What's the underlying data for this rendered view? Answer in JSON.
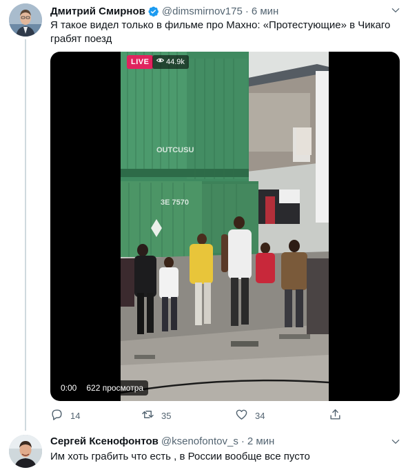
{
  "tweet": {
    "author_name": "Дмитрий Смирнов",
    "handle": "@dimsmirnov175",
    "separator": "·",
    "time": "6 мин",
    "text": "Я такое видел только в фильме про Махно: «Протестующие» в Чикаго грабят поезд",
    "media": {
      "live_label": "LIVE",
      "viewers": "44.9k",
      "video_time": "0:00",
      "video_views": "622 просмотра",
      "container_lettering": [
        "OUTCUSU",
        "3E 7570"
      ]
    },
    "actions": {
      "replies": "14",
      "retweets": "35",
      "likes": "34"
    }
  },
  "reply": {
    "author_name": "Сергей Ксенофонтов",
    "handle": "@ksenofontov_s",
    "separator": "·",
    "time": "2 мин",
    "text": "Им хоть грабить что есть , в России вообще все пусто"
  },
  "colors": {
    "verified_blue": "#1d9bf0",
    "secondary_text": "#536471",
    "live_red": "#e0245e"
  },
  "icons": [
    "verified-badge-icon",
    "chevron-down-icon",
    "eye-icon",
    "reply-icon",
    "retweet-icon",
    "like-icon",
    "share-icon"
  ]
}
